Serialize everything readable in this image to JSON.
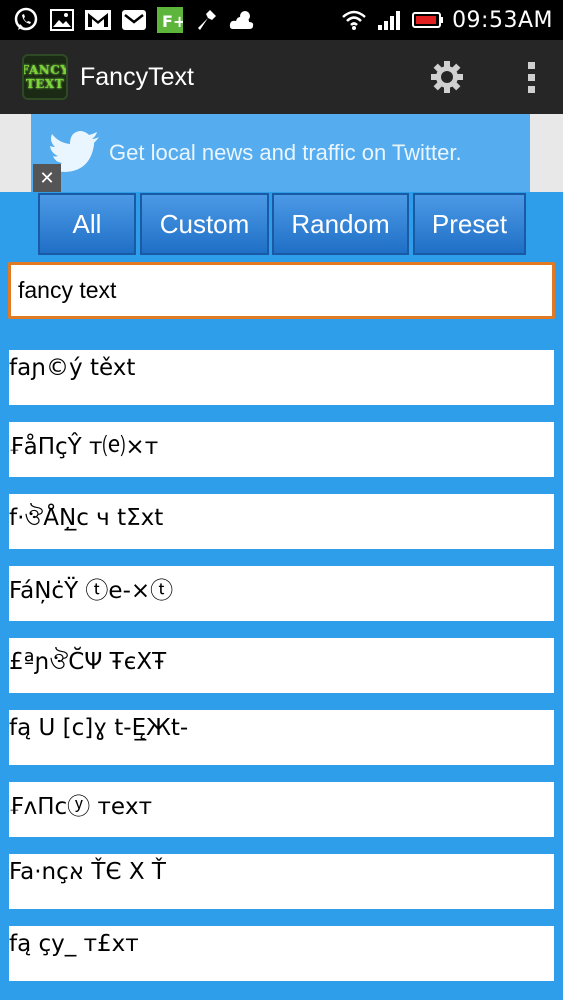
{
  "status_bar": {
    "time": "09:53AM",
    "notification_icons": [
      "whatsapp-icon",
      "gallery-icon",
      "gmail-icon",
      "mail-icon",
      "f-plus-icon",
      "wrench-icon",
      "cloud-icon"
    ],
    "system_icons": [
      "wifi-icon",
      "signal-icon",
      "battery-icon"
    ]
  },
  "action_bar": {
    "logo_line1": "FANCY",
    "logo_line2": "TEXT",
    "title": "FancyText",
    "settings_icon": "gear-icon",
    "overflow_icon": "overflow-menu-icon"
  },
  "ad": {
    "text": "Get local news and traffic on Twitter.",
    "close_label": "✕",
    "accent": "#55acee"
  },
  "tabs": [
    "All",
    "Custom",
    "Random",
    "Preset"
  ],
  "input": {
    "value": "fancy text"
  },
  "results": [
    "faɲ©ý těxt",
    "₣åΠçŶ т⒠×т",
    "f·ঔÅŅ̲c ч tΣxt",
    "FáŅċŸ ⓣe-×ⓣ",
    "£ªɲঔС̆Ψ ŦєΧŦ",
    "fą U [c]ɣ t-Ę̲Жt-",
    "₣ʌΠcⓨ тeхт",
    "Fa·nçא ŤЄ Χ Ť",
    "fą çy_ т£хт"
  ],
  "colors": {
    "background": "#2f9eea",
    "action_bar": "#262626",
    "input_border": "#e07a25",
    "tab_fill": "#2f7fd6"
  }
}
